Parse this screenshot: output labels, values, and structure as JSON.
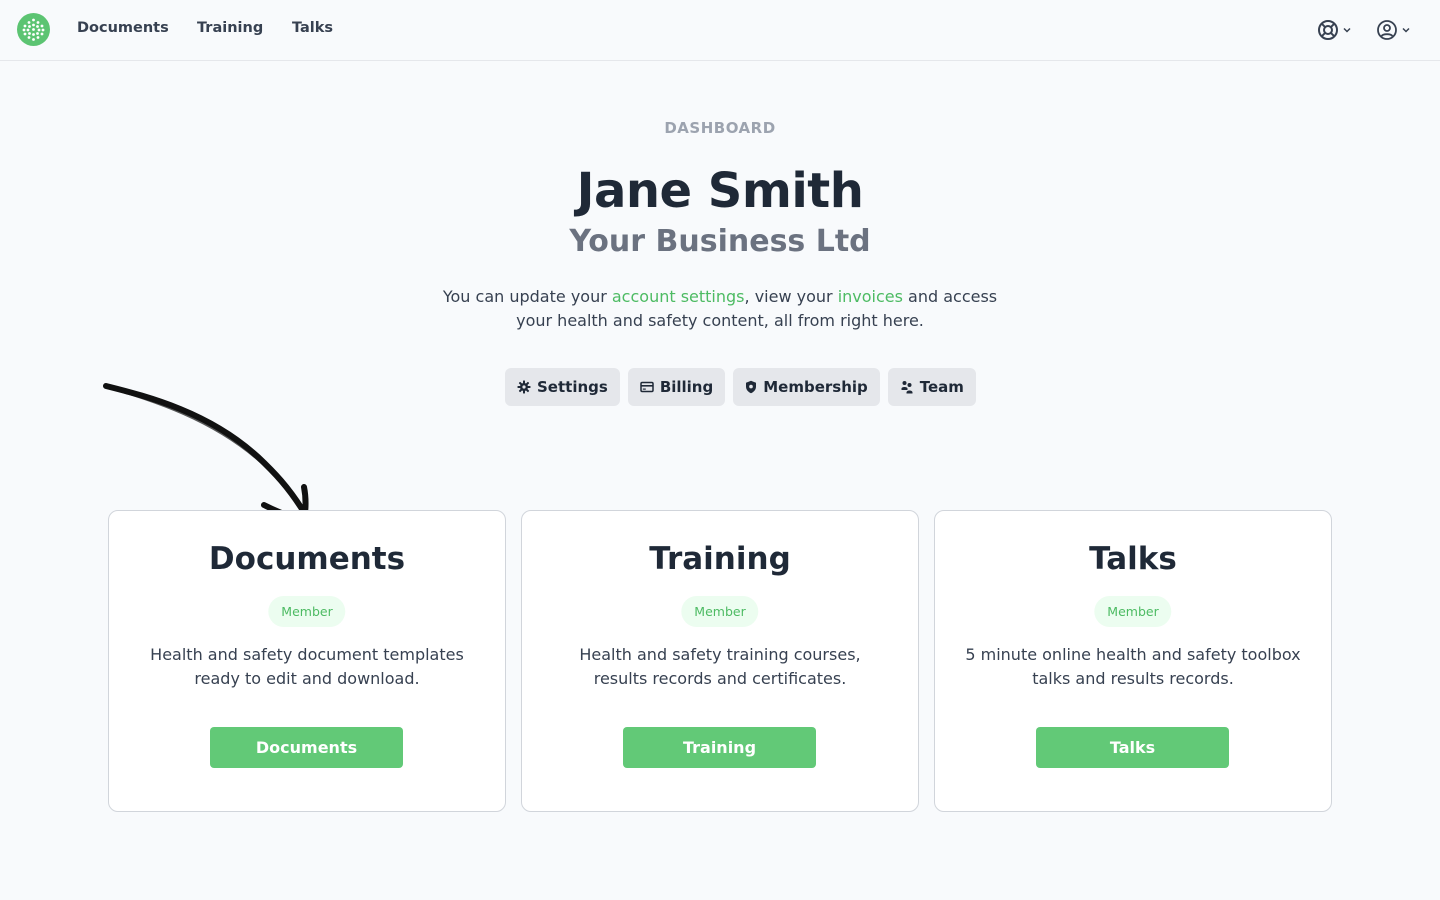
{
  "nav": {
    "items": [
      {
        "label": "Documents"
      },
      {
        "label": "Training"
      },
      {
        "label": "Talks"
      }
    ]
  },
  "header": {
    "eyebrow": "DASHBOARD",
    "name": "Jane Smith",
    "business": "Your Business Ltd"
  },
  "intro": {
    "part1": "You can update your ",
    "link1": "account settings",
    "part2": ", view your ",
    "link2": "invoices",
    "part3": " and access your health and safety content, all from right here."
  },
  "actions": [
    {
      "label": "Settings",
      "icon": "gear-icon"
    },
    {
      "label": "Billing",
      "icon": "credit-card-icon"
    },
    {
      "label": "Membership",
      "icon": "shield-icon"
    },
    {
      "label": "Team",
      "icon": "team-icon"
    }
  ],
  "cards": [
    {
      "title": "Documents",
      "badge": "Member",
      "description": "Health and safety document templates ready to edit and download.",
      "button": "Documents"
    },
    {
      "title": "Training",
      "badge": "Member",
      "description": "Health and safety training courses, results records and certificates.",
      "button": "Training"
    },
    {
      "title": "Talks",
      "badge": "Member",
      "description": "5 minute online health and safety toolbox talks and results records.",
      "button": "Talks"
    }
  ],
  "colors": {
    "accent": "#62c977",
    "link": "#4dbb63",
    "background": "#f8fafc"
  }
}
